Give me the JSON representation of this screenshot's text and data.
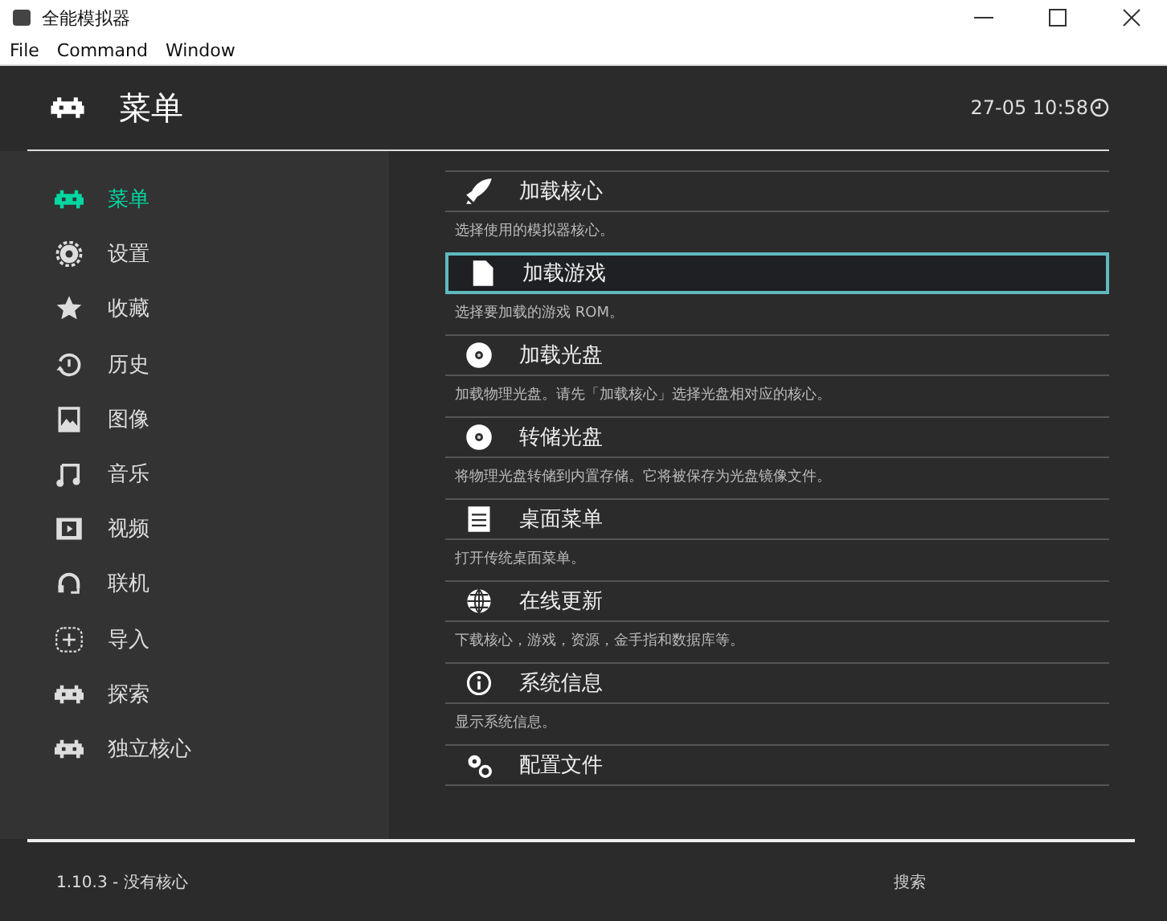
{
  "window": {
    "title": "全能模拟器"
  },
  "menubar": [
    "File",
    "Command",
    "Window"
  ],
  "header": {
    "title": "菜单",
    "clock": "27-05 10:58"
  },
  "sidebar": {
    "items": [
      {
        "label": "菜单",
        "selected": true
      },
      {
        "label": "设置",
        "selected": false
      },
      {
        "label": "收藏",
        "selected": false
      },
      {
        "label": "历史",
        "selected": false
      },
      {
        "label": "图像",
        "selected": false
      },
      {
        "label": "音乐",
        "selected": false
      },
      {
        "label": "视频",
        "selected": false
      },
      {
        "label": "联机",
        "selected": false
      },
      {
        "label": "导入",
        "selected": false
      },
      {
        "label": "探索",
        "selected": false
      },
      {
        "label": "独立核心",
        "selected": false
      }
    ]
  },
  "content": {
    "items": [
      {
        "label": "加载核心",
        "description": "选择使用的模拟器核心。",
        "selected": false
      },
      {
        "label": "加载游戏",
        "description": "选择要加载的游戏 ROM。",
        "selected": true
      },
      {
        "label": "加载光盘",
        "description": "加载物理光盘。请先「加载核心」选择光盘相对应的核心。",
        "selected": false
      },
      {
        "label": "转储光盘",
        "description": "将物理光盘转储到内置存储。它将被保存为光盘镜像文件。",
        "selected": false
      },
      {
        "label": "桌面菜单",
        "description": "打开传统桌面菜单。",
        "selected": false
      },
      {
        "label": "在线更新",
        "description": "下载核心，游戏，资源，金手指和数据库等。",
        "selected": false
      },
      {
        "label": "系统信息",
        "description": "显示系统信息。",
        "selected": false
      },
      {
        "label": "配置文件",
        "selected": false
      }
    ]
  },
  "footer": {
    "version": "1.10.3 - 没有核心",
    "hint": "搜索"
  }
}
